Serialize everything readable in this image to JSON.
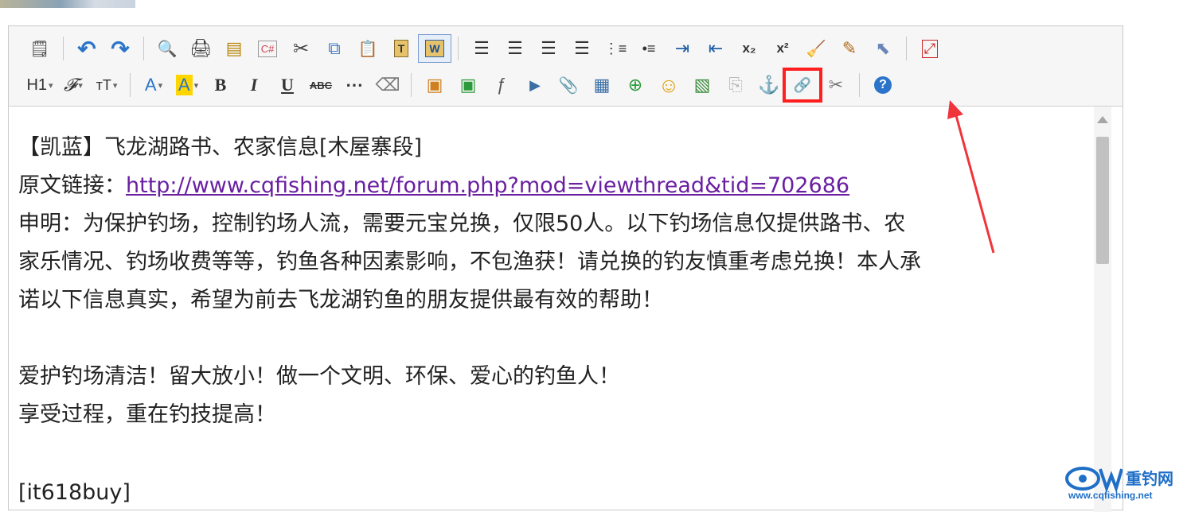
{
  "toolbar": {
    "row1": [
      {
        "name": "source-icon",
        "glyph": "🗒"
      },
      {
        "name": "undo-icon",
        "glyph": "↶"
      },
      {
        "name": "redo-icon",
        "glyph": "↷"
      },
      {
        "name": "preview-icon",
        "glyph": "🔍"
      },
      {
        "name": "print-icon",
        "glyph": "🖨"
      },
      {
        "name": "template-icon",
        "glyph": "▤"
      },
      {
        "name": "code-icon",
        "glyph": "C#"
      },
      {
        "name": "cut-icon",
        "glyph": "✂"
      },
      {
        "name": "copy-icon",
        "glyph": "⧉"
      },
      {
        "name": "paste-icon",
        "glyph": "📋"
      },
      {
        "name": "paste-text-icon",
        "glyph": "T"
      },
      {
        "name": "paste-word-icon",
        "glyph": "W"
      },
      {
        "name": "align-left-icon",
        "glyph": "☰"
      },
      {
        "name": "align-center-icon",
        "glyph": "☰"
      },
      {
        "name": "align-right-icon",
        "glyph": "☰"
      },
      {
        "name": "justify-icon",
        "glyph": "☰"
      },
      {
        "name": "ordered-list-icon",
        "glyph": "⋮≡"
      },
      {
        "name": "unordered-list-icon",
        "glyph": "•≡"
      },
      {
        "name": "indent-icon",
        "glyph": "⇥"
      },
      {
        "name": "outdent-icon",
        "glyph": "⇤"
      },
      {
        "name": "subscript-icon",
        "glyph": "x₂"
      },
      {
        "name": "superscript-icon",
        "glyph": "x²"
      },
      {
        "name": "clear-format-icon",
        "glyph": "🧹"
      },
      {
        "name": "quick-format-icon",
        "glyph": "✎"
      },
      {
        "name": "select-all-icon",
        "glyph": "⬉"
      },
      {
        "name": "fullscreen-icon",
        "glyph": "⤢"
      }
    ],
    "row2": [
      {
        "name": "heading-icon",
        "glyph": "H1"
      },
      {
        "name": "font-family-icon",
        "glyph": "𝓕"
      },
      {
        "name": "font-size-icon",
        "glyph": "тT"
      },
      {
        "name": "font-color-icon",
        "glyph": "A"
      },
      {
        "name": "highlight-color-icon",
        "glyph": "A"
      },
      {
        "name": "bold-icon",
        "glyph": "B"
      },
      {
        "name": "italic-icon",
        "glyph": "I"
      },
      {
        "name": "underline-icon",
        "glyph": "U"
      },
      {
        "name": "strikethrough-icon",
        "glyph": "ABC"
      },
      {
        "name": "horizontal-rule-icon",
        "glyph": "⋯"
      },
      {
        "name": "eraser-icon",
        "glyph": "⌫"
      },
      {
        "name": "insert-image-icon",
        "glyph": "▣"
      },
      {
        "name": "multi-image-icon",
        "glyph": "▣"
      },
      {
        "name": "flash-icon",
        "glyph": "ƒ"
      },
      {
        "name": "media-icon",
        "glyph": "▶"
      },
      {
        "name": "attachment-icon",
        "glyph": "📎"
      },
      {
        "name": "table-icon",
        "glyph": "▦"
      },
      {
        "name": "insert-row-icon",
        "glyph": "⊕"
      },
      {
        "name": "emoticon-icon",
        "glyph": "☺"
      },
      {
        "name": "map-image-icon",
        "glyph": "▧"
      },
      {
        "name": "page-break-icon",
        "glyph": "⎘"
      },
      {
        "name": "anchor-icon",
        "glyph": "⚓"
      },
      {
        "name": "link-icon",
        "glyph": "🔗"
      },
      {
        "name": "unlink-icon",
        "glyph": "✂"
      },
      {
        "name": "help-icon",
        "glyph": "?"
      }
    ]
  },
  "content": {
    "line1": "【凯蓝】飞龙湖路书、农家信息[木屋寨段]",
    "line2_prefix": "原文链接：",
    "line2_link": "http://www.cqfishing.net/forum.php?mod=viewthread&tid=702686",
    "line3": "申明：为保护钓场，控制钓场人流，需要元宝兑换，仅限50人。以下钓场信息仅提供路书、农",
    "line4": "家乐情况、钓场收费等等，钓鱼各种因素影响，不包渔获！请兑换的钓友慎重考虑兑换！本人承",
    "line5": "诺以下信息真实，希望为前去飞龙湖钓鱼的朋友提供最有效的帮助！",
    "line6": "爱护钓场清洁！留大放小！做一个文明、环保、爱心的钓鱼人！",
    "line7": "享受过程，重在钓技提高！",
    "line8": "[it618buy]"
  },
  "watermark": {
    "brand": "重钓网",
    "url": "www.cqfishing.net"
  },
  "colors": {
    "highlight_box": "#ff1f1f",
    "arrow": "#f0343a",
    "link": "#6a1fa0"
  }
}
